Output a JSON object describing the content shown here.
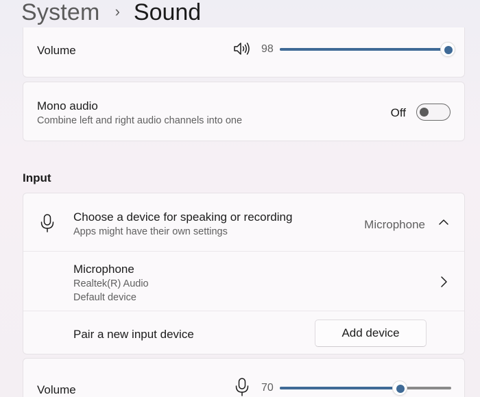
{
  "breadcrumb": {
    "parent": "System",
    "separator": "›",
    "current": "Sound"
  },
  "output_volume": {
    "label": "Volume",
    "icon": "speaker-volume-icon",
    "value": "98",
    "level": 0.98
  },
  "mono_audio": {
    "label": "Mono audio",
    "description": "Combine left and right audio channels into one",
    "state_text": "Off",
    "enabled": false
  },
  "input_section": {
    "title": "Input",
    "choose_device": {
      "label": "Choose a device for speaking or recording",
      "description": "Apps might have their own settings",
      "selected": "Microphone",
      "icon": "microphone-icon",
      "expanded": true
    },
    "device": {
      "name": "Microphone",
      "driver": "Realtek(R) Audio",
      "status": "Default device"
    },
    "pair": {
      "label": "Pair a new input device",
      "button": "Add device"
    }
  },
  "input_volume": {
    "label": "Volume",
    "icon": "microphone-icon",
    "value": "70",
    "level": 0.7
  },
  "colors": {
    "accent": "#3f6a96",
    "background": "#f3eff4",
    "card": "#fbf9fb"
  }
}
